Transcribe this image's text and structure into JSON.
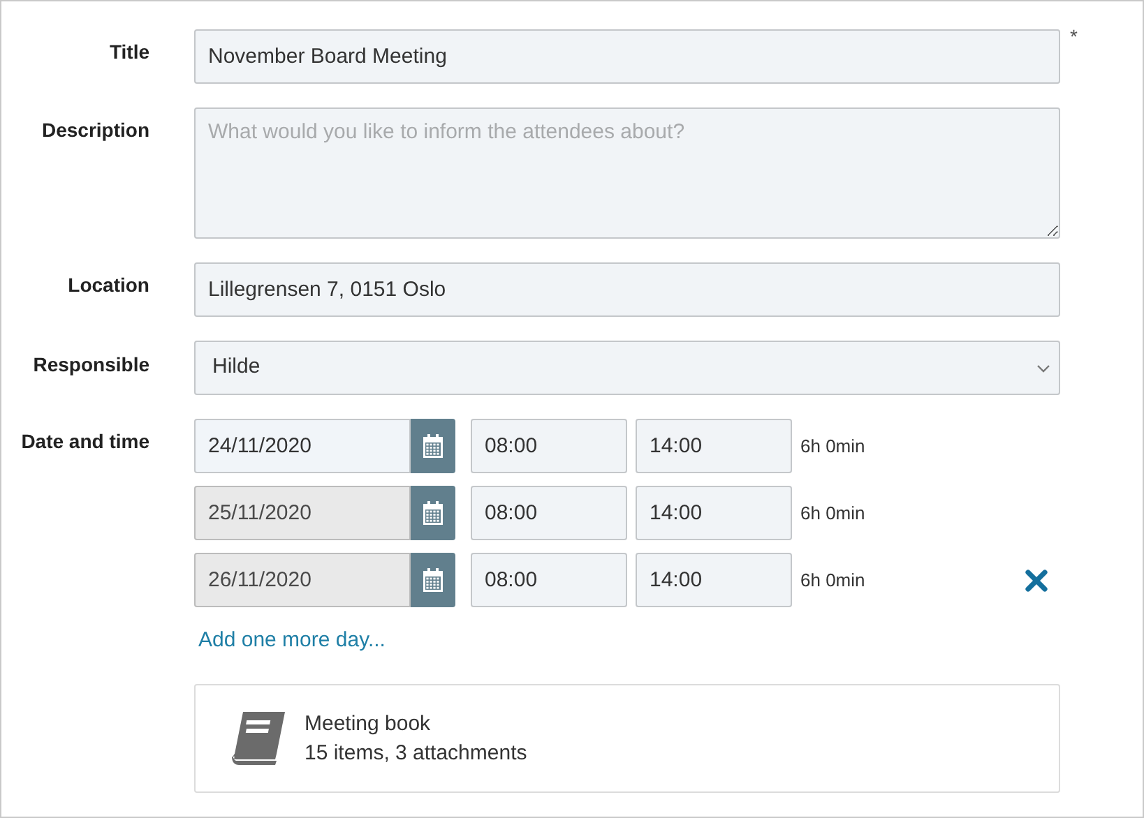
{
  "fields": [
    {
      "label": "Title",
      "kind": "text",
      "value": "November Board Meeting",
      "required_mark": "*"
    },
    {
      "label": "Description",
      "kind": "textarea",
      "placeholder": "What would you like to inform the attendees about?"
    },
    {
      "label": "Location",
      "kind": "text",
      "value": "Lillegrensen 7, 0151 Oslo"
    },
    {
      "label": "Responsible",
      "kind": "select",
      "value": "Hilde"
    }
  ],
  "date_time": {
    "label": "Date and time",
    "rows": [
      {
        "date": "24/11/2020",
        "disabled": false,
        "start": "08:00",
        "end": "14:00",
        "duration": "6h 0min",
        "removable": false
      },
      {
        "date": "25/11/2020",
        "disabled": true,
        "start": "08:00",
        "end": "14:00",
        "duration": "6h 0min",
        "removable": false
      },
      {
        "date": "26/11/2020",
        "disabled": true,
        "start": "08:00",
        "end": "14:00",
        "duration": "6h 0min",
        "removable": true
      }
    ],
    "add_link": "Add one more day..."
  },
  "meeting_book": {
    "title": "Meeting book",
    "summary": "15 items, 3 attachments"
  }
}
